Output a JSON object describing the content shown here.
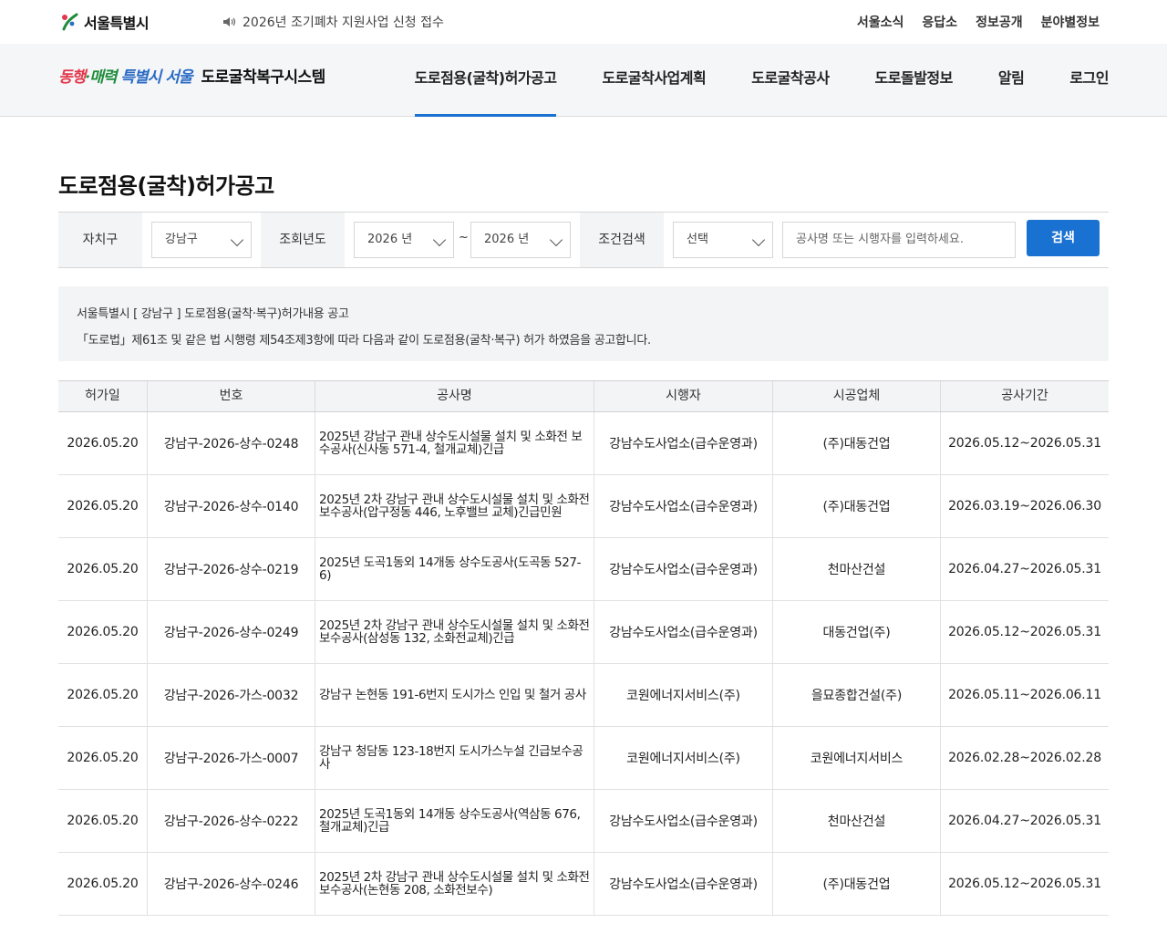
{
  "topbar": {
    "logo_text": "서울특별시",
    "notice": "2026년 조기폐차 지원사업 신청 접수",
    "util_menu": [
      "서울소식",
      "응답소",
      "정보공개",
      "분야별정보"
    ]
  },
  "header": {
    "slogan": [
      "동행",
      "·매력",
      " 특별시 서울"
    ],
    "system_title": "도로굴착복구시스템",
    "nav": [
      "도로점용(굴착)허가공고",
      "도로굴착사업계획",
      "도로굴착공사",
      "도로돌발정보",
      "알림",
      "로그인"
    ],
    "active_nav": 0,
    "accent_color": "#1971d1"
  },
  "page_title": "도로점용(굴착)허가공고",
  "search": {
    "district_label": "자치구",
    "district_value": "강남구",
    "year_label": "조회년도",
    "year_from": "2026 년",
    "year_separator": "~",
    "year_to": "2026 년",
    "condition_label": "조건검색",
    "condition_value": "선택",
    "keyword_placeholder": "공사명 또는 시행자를 입력하세요.",
    "button_label": "검색"
  },
  "info": {
    "line1": "서울특별시 [ 강남구 ] 도로점용(굴착·복구)허가내용 공고",
    "line2": "「도로법」제61조 및 같은 법 시행령 제54조제3항에 따라 다음과 같이 도로점용(굴착·복구) 허가 하였음을 공고합니다."
  },
  "table": {
    "columns": [
      "허가일",
      "번호",
      "공사명",
      "시행자",
      "시공업체",
      "공사기간"
    ],
    "rows": [
      [
        "2026.05.20",
        "강남구-2026-상수-0248",
        "2025년 강남구 관내 상수도시설물 설치 및 소화전 보수공사(신사동 571-4, 철개교체)긴급",
        "강남수도사업소(급수운영과)",
        "(주)대동건업",
        "2026.05.12~2026.05.31"
      ],
      [
        "2026.05.20",
        "강남구-2026-상수-0140",
        "2025년 2차 강남구 관내 상수도시설물 설치 및 소화전 보수공사(압구정동 446, 노후밸브 교체)긴급민원",
        "강남수도사업소(급수운영과)",
        "(주)대동건업",
        "2026.03.19~2026.06.30"
      ],
      [
        "2026.05.20",
        "강남구-2026-상수-0219",
        "2025년 도곡1동외 14개동 상수도공사(도곡동 527-6)",
        "강남수도사업소(급수운영과)",
        "천마산건설",
        "2026.04.27~2026.05.31"
      ],
      [
        "2026.05.20",
        "강남구-2026-상수-0249",
        "2025년 2차 강남구 관내 상수도시설물 설치 및 소화전 보수공사(삼성동 132, 소화전교체)긴급",
        "강남수도사업소(급수운영과)",
        "대동건업(주)",
        "2026.05.12~2026.05.31"
      ],
      [
        "2026.05.20",
        "강남구-2026-가스-0032",
        "강남구 논현동 191-6번지 도시가스 인입 및 철거 공사",
        "코원에너지서비스(주)",
        "을묘종합건설(주)",
        "2026.05.11~2026.06.11"
      ],
      [
        "2026.05.20",
        "강남구-2026-가스-0007",
        "강남구 청담동 123-18번지 도시가스누설 긴급보수공사",
        "코원에너지서비스(주)",
        "코원에너지서비스",
        "2026.02.28~2026.02.28"
      ],
      [
        "2026.05.20",
        "강남구-2026-상수-0222",
        "2025년 도곡1동외 14개동 상수도공사(역삼동 676, 철개교체)긴급",
        "강남수도사업소(급수운영과)",
        "천마산건설",
        "2026.04.27~2026.05.31"
      ],
      [
        "2026.05.20",
        "강남구-2026-상수-0246",
        "2025년 2차 강남구 관내 상수도시설물 설치 및 소화전 보수공사(논현동 208, 소화전보수)",
        "강남수도사업소(급수운영과)",
        "(주)대동건업",
        "2026.05.12~2026.05.31"
      ]
    ]
  }
}
